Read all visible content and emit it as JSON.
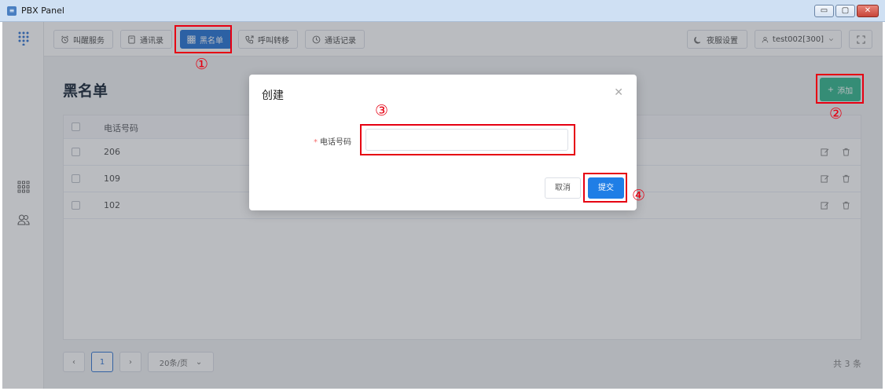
{
  "window": {
    "title": "PBX Panel"
  },
  "topbar": {
    "tabs": [
      {
        "label": "叫醒服务",
        "icon": "alarm-clock-icon"
      },
      {
        "label": "通讯录",
        "icon": "contacts-book-icon"
      },
      {
        "label": "黑名单",
        "icon": "grid-icon"
      },
      {
        "label": "呼叫转移",
        "icon": "phone-forward-icon"
      },
      {
        "label": "通话记录",
        "icon": "clock-icon"
      }
    ],
    "night_service": "夜服设置",
    "user": "test002[300]"
  },
  "page": {
    "title": "黑名单",
    "add_button": "添加",
    "column_header": "电话号码",
    "rows": [
      "206",
      "109",
      "102"
    ],
    "pagination": {
      "current_page": "1",
      "page_size": "20条/页",
      "total": "共 3 条"
    }
  },
  "modal": {
    "title": "创建",
    "required_mark": "*",
    "field_label": "电话号码",
    "field_value": "",
    "cancel": "取消",
    "submit": "提交"
  },
  "annotations": {
    "n1": "①",
    "n2": "②",
    "n3": "③",
    "n4": "④"
  },
  "colors": {
    "accent": "#2f7ad6",
    "add_green": "#3cba92",
    "annotation_red": "#e60012",
    "submit_blue": "#1f7ee6"
  }
}
